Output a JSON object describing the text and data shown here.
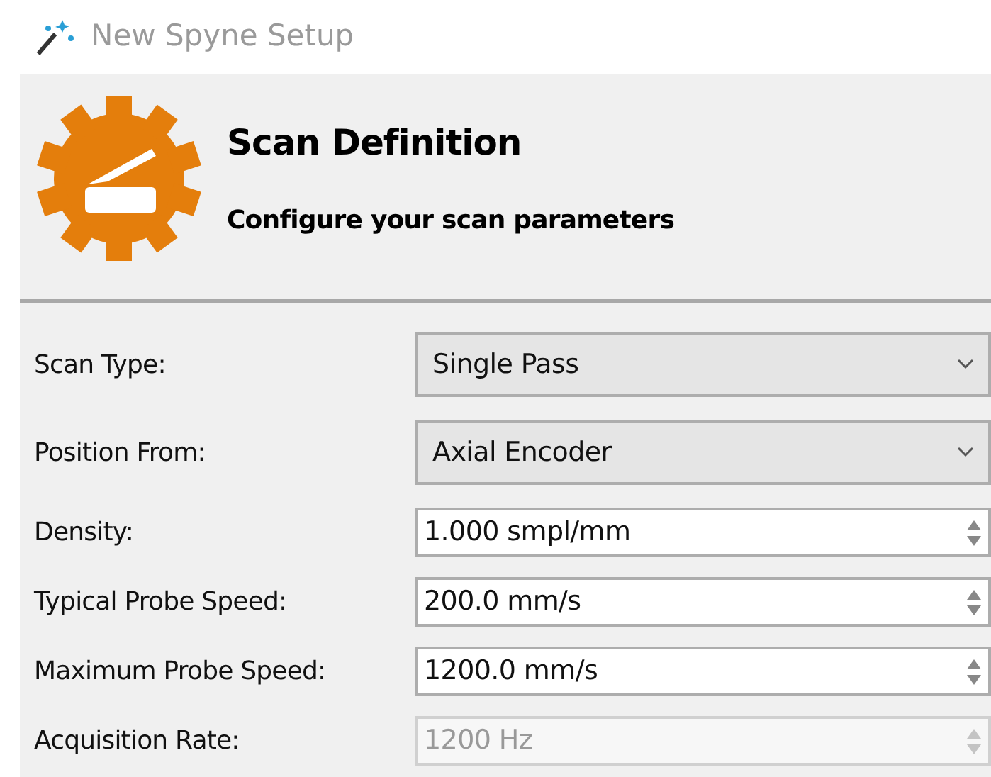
{
  "window": {
    "title": "New Spyne Setup"
  },
  "header": {
    "title": "Scan Definition",
    "subtitle": "Configure your scan parameters"
  },
  "fields": [
    {
      "label": "Scan Type:",
      "kind": "combo",
      "value": "Single Pass",
      "disabled": false
    },
    {
      "label": "Position From:",
      "kind": "combo",
      "value": "Axial Encoder",
      "disabled": false
    },
    {
      "label": "Density:",
      "kind": "spin",
      "value": "1.000 smpl/mm",
      "disabled": false
    },
    {
      "label": "Typical Probe Speed:",
      "kind": "spin",
      "value": "200.0 mm/s",
      "disabled": false
    },
    {
      "label": "Maximum Probe Speed:",
      "kind": "spin",
      "value": "1200.0 mm/s",
      "disabled": false
    },
    {
      "label": "Acquisition Rate:",
      "kind": "spin",
      "value": "1200 Hz",
      "disabled": true
    }
  ]
}
